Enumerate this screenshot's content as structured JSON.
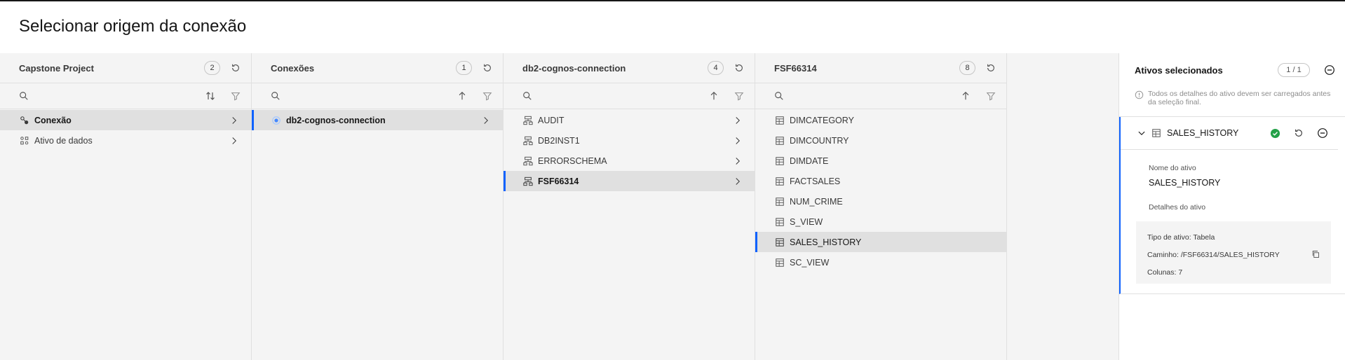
{
  "page": {
    "title": "Selecionar origem da conexão"
  },
  "colors": {
    "accent": "#0f62fe",
    "success": "#24a148",
    "selected_row": "#e0e0e0",
    "column_bg": "#f4f4f4"
  },
  "columns": [
    {
      "title": "Capstone Project",
      "count": "2",
      "rows": [
        {
          "label": "Conexão",
          "icon": "connection-icon",
          "selected": true,
          "chevron": true
        },
        {
          "label": "Ativo de dados",
          "icon": "data-asset-icon",
          "selected": false,
          "chevron": true
        }
      ]
    },
    {
      "title": "Conexões",
      "count": "1",
      "rows": [
        {
          "label": "db2-cognos-connection",
          "icon": "db-connection-icon",
          "selected": true,
          "chevron": true
        }
      ]
    },
    {
      "title": "db2-cognos-connection",
      "count": "4",
      "rows": [
        {
          "label": "AUDIT",
          "icon": "schema-icon",
          "selected": false,
          "chevron": true
        },
        {
          "label": "DB2INST1",
          "icon": "schema-icon",
          "selected": false,
          "chevron": true
        },
        {
          "label": "ERRORSCHEMA",
          "icon": "schema-icon",
          "selected": false,
          "chevron": true
        },
        {
          "label": "FSF66314",
          "icon": "schema-icon",
          "selected": true,
          "chevron": true
        }
      ]
    },
    {
      "title": "FSF66314",
      "count": "8",
      "rows": [
        {
          "label": "DIMCATEGORY",
          "icon": "table-icon",
          "selected": false
        },
        {
          "label": "DIMCOUNTRY",
          "icon": "table-icon",
          "selected": false
        },
        {
          "label": "DIMDATE",
          "icon": "table-icon",
          "selected": false
        },
        {
          "label": "FACTSALES",
          "icon": "table-icon",
          "selected": false
        },
        {
          "label": "NUM_CRIME",
          "icon": "table-icon",
          "selected": false
        },
        {
          "label": "S_VIEW",
          "icon": "table-icon",
          "selected": false
        },
        {
          "label": "SALES_HISTORY",
          "icon": "table-icon",
          "selected": true
        },
        {
          "label": "SC_VIEW",
          "icon": "table-icon",
          "selected": false
        }
      ]
    }
  ],
  "panel": {
    "title": "Ativos selecionados",
    "count": "1 / 1",
    "notice": "Todos os detalhes do ativo devem ser carregados antes da seleção final.",
    "asset": {
      "name": "SALES_HISTORY",
      "name_label": "Nome do ativo",
      "name_value": "SALES_HISTORY",
      "details_label": "Detalhes do ativo",
      "type_line": "Tipo de ativo: Tabela",
      "path_line": "Caminho: /FSF66314/SALES_HISTORY",
      "columns_line": "Colunas: 7"
    }
  }
}
